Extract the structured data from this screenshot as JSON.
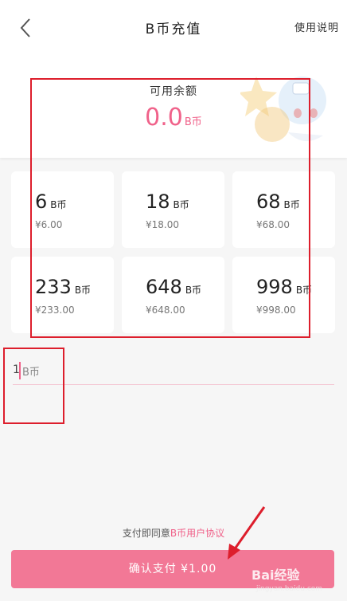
{
  "header": {
    "title": "B币充值",
    "help_label": "使用说明",
    "back_icon": "chevron-left-icon"
  },
  "balance": {
    "label": "可用余额",
    "value": "0.0",
    "unit": "B币"
  },
  "packages": [
    {
      "amount": "6",
      "unit": "B币",
      "price": "¥6.00"
    },
    {
      "amount": "18",
      "unit": "B币",
      "price": "¥18.00"
    },
    {
      "amount": "68",
      "unit": "B币",
      "price": "¥68.00"
    },
    {
      "amount": "233",
      "unit": "B币",
      "price": "¥233.00"
    },
    {
      "amount": "648",
      "unit": "B币",
      "price": "¥648.00"
    },
    {
      "amount": "998",
      "unit": "B币",
      "price": "¥998.00"
    }
  ],
  "custom_amount": {
    "value": "1",
    "unit": "B币"
  },
  "agreement": {
    "prefix": "支付即同意",
    "link": "B币用户协议"
  },
  "pay_button": {
    "label": "确认支付 ¥1.00"
  },
  "watermark": {
    "text": "Bai经验",
    "sub": "jingyan.baidu.com"
  },
  "colors": {
    "accent": "#f0628a",
    "button": "#f27896",
    "annotation": "#dd1e2c"
  }
}
